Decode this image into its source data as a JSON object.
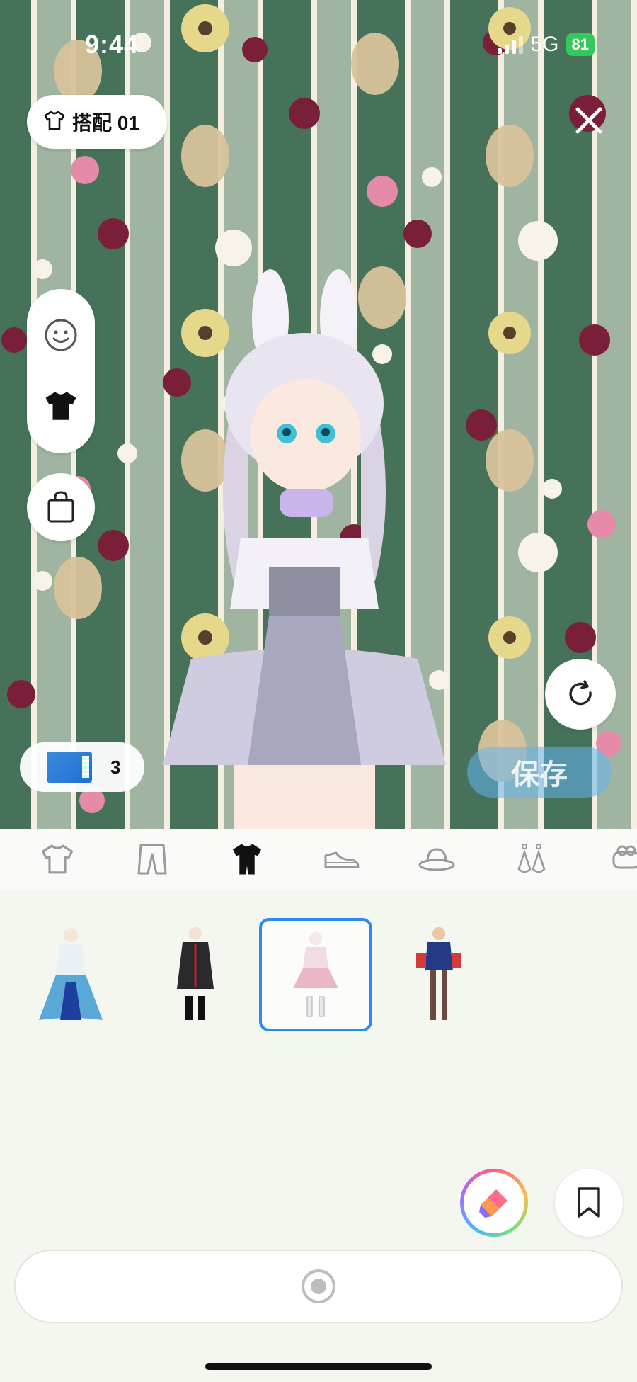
{
  "status_bar": {
    "time": "9:44",
    "network": "5G",
    "battery": "81"
  },
  "header": {
    "outfit_label": "搭配 01"
  },
  "tickets": {
    "count": "3"
  },
  "save_label": "保存",
  "icons": {
    "outfit": "tshirt-outline-icon",
    "close": "close-icon",
    "face": "face-icon",
    "clothes": "tshirt-filled-icon",
    "bag": "shopping-bag-icon",
    "refresh": "refresh-icon",
    "magic": "magic-wand-icon",
    "bookmark": "bookmark-icon",
    "capture": "capture-icon"
  },
  "categories": [
    {
      "name": "top",
      "icon": "tshirt-icon",
      "selected": false
    },
    {
      "name": "bottom",
      "icon": "pants-icon",
      "selected": false
    },
    {
      "name": "set",
      "icon": "outfit-set-icon",
      "selected": true
    },
    {
      "name": "shoes",
      "icon": "shoe-icon",
      "selected": false
    },
    {
      "name": "hat",
      "icon": "hat-icon",
      "selected": false
    },
    {
      "name": "earrings",
      "icon": "earrings-icon",
      "selected": false
    },
    {
      "name": "accessory",
      "icon": "accessory-icon",
      "selected": false
    }
  ],
  "items": [
    {
      "name": "blue-gown",
      "selected": false
    },
    {
      "name": "black-coat",
      "selected": false
    },
    {
      "name": "pink-lolita-dress",
      "selected": true
    },
    {
      "name": "magician-outfit",
      "selected": false
    }
  ],
  "colors": {
    "accent": "#2a8af0",
    "wall_green": "#46725a",
    "battery": "#34c759"
  }
}
